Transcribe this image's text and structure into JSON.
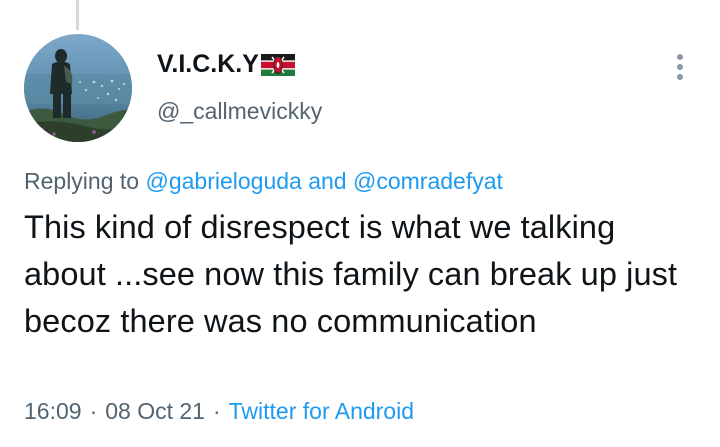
{
  "tweet": {
    "display_name": "V.I.C.K.Y",
    "flag_icon": "kenya-flag-icon",
    "handle": "@_callmevickky",
    "more_icon": "more-options-vertical-icon",
    "replying_prefix": "Replying to",
    "reply_mention_1": "@gabrieloguda",
    "reply_conjunction": "and",
    "reply_mention_2": "@comradefyat",
    "text": "This kind of disrespect is what we talking about ...see now this family can break up just becoz there was no communication",
    "time": "16:09",
    "date": "08 Oct 21",
    "separator": "·",
    "source": "Twitter for Android"
  },
  "colors": {
    "primary_text": "#0f1419",
    "secondary_text": "#536471",
    "link": "#1d9bf0",
    "thread_line": "#cfd9de"
  }
}
